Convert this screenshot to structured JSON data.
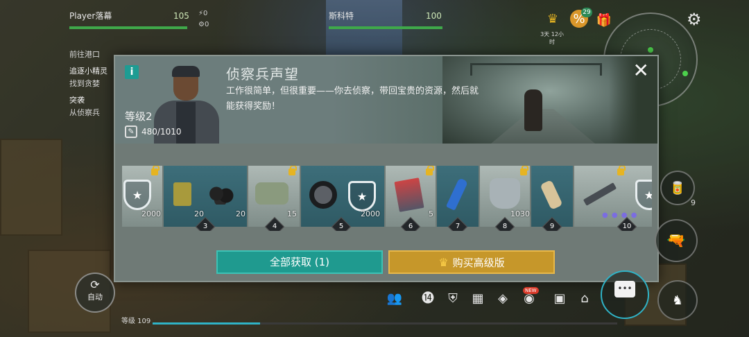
{
  "hud": {
    "player1": {
      "name": "Player落幕",
      "hp": "105",
      "stat_a": "0",
      "stat_b": "0"
    },
    "player2": {
      "name": "斯科特",
      "hp": "100"
    },
    "timer": "3天 12小时",
    "gift_badge": "29",
    "sale_icon": "%",
    "quests": {
      "q1_sub": "前往港口",
      "q2_title": "追逐小精灵",
      "q2_sub": "找到贪婪",
      "q3_title": "突袭",
      "q3_sub": "从侦察兵"
    }
  },
  "modal": {
    "title": "侦察兵声望",
    "description": "工作很简单，但很重要——你去侦察，带回宝贵的资源，然后就能获得奖励！",
    "level": "等级2",
    "reputation": "480/1010",
    "rewards": [
      {
        "tier": "",
        "free_qty": "2000",
        "items": [
          "shield-token"
        ]
      },
      {
        "tier": "3",
        "premium_qty_a": "20",
        "premium_qty_b": "20",
        "items": [
          "jerry-can",
          "coal"
        ]
      },
      {
        "tier": "4",
        "free_qty": "15",
        "items": [
          "bag"
        ]
      },
      {
        "tier": "5",
        "premium_qty": "2000",
        "items": [
          "tire",
          "shield-token"
        ]
      },
      {
        "tier": "6",
        "free_qty": "5",
        "items": [
          "magazine"
        ]
      },
      {
        "tier": "7",
        "items": [
          "bottle"
        ]
      },
      {
        "tier": "8",
        "free_qty": "1030",
        "items": [
          "armor"
        ]
      },
      {
        "tier": "9",
        "items": [
          "scroll"
        ]
      },
      {
        "tier": "10",
        "items": [
          "rifle"
        ]
      }
    ],
    "claim_button": "全部获取 (1)",
    "buy_button": "购买高级版"
  },
  "bottom": {
    "auto_label": "自动",
    "xp_label": "等级 109",
    "new_badge": "NEW",
    "right_item_count": "9"
  },
  "colors": {
    "claim": "#1f9a8f",
    "buy": "#c6972a",
    "hp": "#3fa84a",
    "accent": "#1e9c93"
  }
}
